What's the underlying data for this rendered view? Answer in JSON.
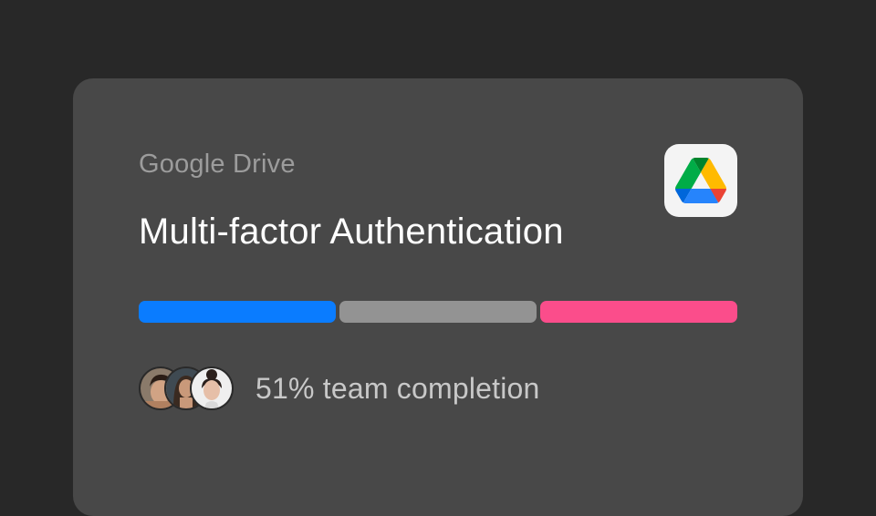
{
  "card": {
    "app_name": "Google Drive",
    "title": "Multi-factor Authentication",
    "app_icon": "google-drive-icon",
    "progress_segments": [
      {
        "color": "#0a7cff"
      },
      {
        "color": "#939393"
      },
      {
        "color": "#fb4d8b"
      }
    ],
    "team": {
      "avatars": [
        "avatar-man-dark-hair",
        "avatar-woman-long-hair",
        "avatar-woman-hair-bun"
      ],
      "completion_text": "51% team completion",
      "completion_percent": 51
    }
  },
  "colors": {
    "background": "#282828",
    "card": "#484848",
    "muted_text": "#9c9c9c",
    "title_text": "#ffffff"
  }
}
